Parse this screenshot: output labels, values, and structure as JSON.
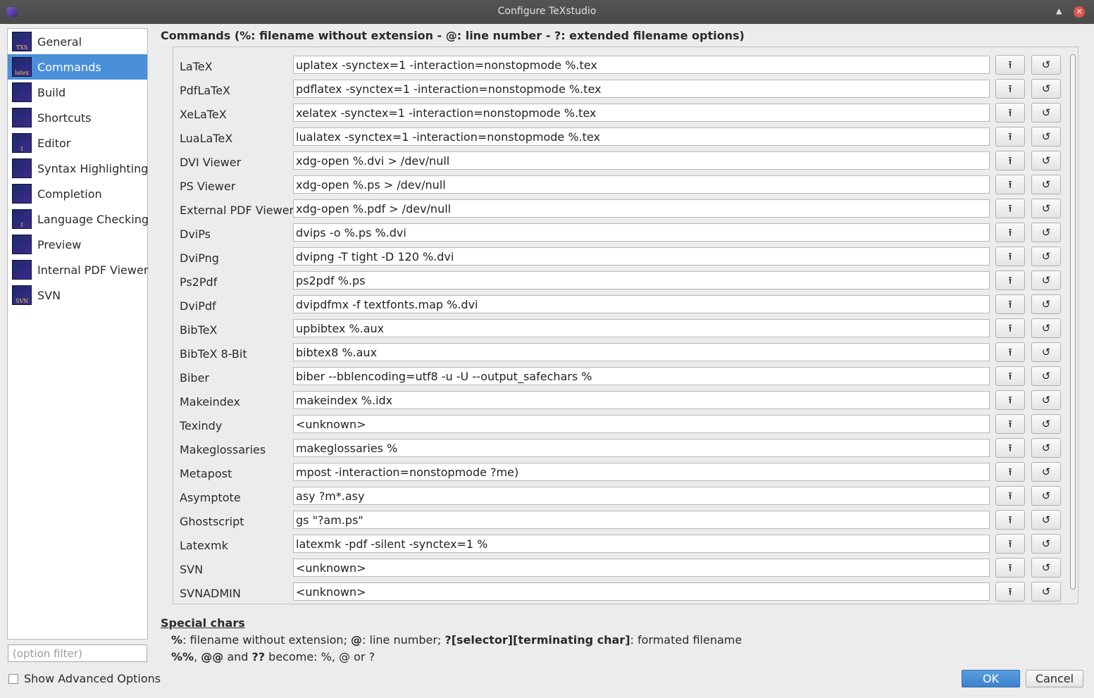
{
  "window": {
    "title": "Configure TeXstudio",
    "maximize_glyph": "▲",
    "close_glyph": "✕"
  },
  "sidebar": {
    "items": [
      {
        "label": "General",
        "icon": "txs-icon",
        "icon_text": "TXS"
      },
      {
        "label": "Commands",
        "icon": "latex-icon",
        "icon_text": "latex"
      },
      {
        "label": "Build",
        "icon": "build-icon",
        "icon_text": ""
      },
      {
        "label": "Shortcuts",
        "icon": "keyboard-icon",
        "icon_text": ""
      },
      {
        "label": "Editor",
        "icon": "text-cursor-icon",
        "icon_text": "I"
      },
      {
        "label": "Syntax Highlighting",
        "icon": "highlight-icon",
        "icon_text": ""
      },
      {
        "label": "Completion",
        "icon": "completion-icon",
        "icon_text": ""
      },
      {
        "label": "Language Checking",
        "icon": "spellcheck-icon",
        "icon_text": "I"
      },
      {
        "label": "Preview",
        "icon": "preview-icon",
        "icon_text": ""
      },
      {
        "label": "Internal PDF Viewer",
        "icon": "pdf-viewer-icon",
        "icon_text": ""
      },
      {
        "label": "SVN",
        "icon": "svn-icon",
        "icon_text": "SVN"
      }
    ],
    "selected_index": 1
  },
  "filter": {
    "placeholder": "(option filter)",
    "value": ""
  },
  "advanced": {
    "label": "Show Advanced Options",
    "checked": false
  },
  "commands": {
    "heading": "Commands (%: filename without extension - @: line number - ?: extended filename options)",
    "browse_glyph": "⭱",
    "reset_glyph": "↺",
    "rows": [
      {
        "label": "LaTeX",
        "value": "uplatex -synctex=1 -interaction=nonstopmode %.tex"
      },
      {
        "label": "PdfLaTeX",
        "value": "pdflatex -synctex=1 -interaction=nonstopmode %.tex"
      },
      {
        "label": "XeLaTeX",
        "value": "xelatex -synctex=1 -interaction=nonstopmode %.tex"
      },
      {
        "label": "LuaLaTeX",
        "value": "lualatex -synctex=1 -interaction=nonstopmode %.tex"
      },
      {
        "label": "DVI Viewer",
        "value": "xdg-open %.dvi > /dev/null"
      },
      {
        "label": "PS Viewer",
        "value": "xdg-open %.ps > /dev/null"
      },
      {
        "label": "External PDF Viewer",
        "value": "xdg-open %.pdf > /dev/null"
      },
      {
        "label": "DviPs",
        "value": "dvips -o %.ps %.dvi"
      },
      {
        "label": "DviPng",
        "value": "dvipng -T tight -D 120 %.dvi"
      },
      {
        "label": "Ps2Pdf",
        "value": "ps2pdf %.ps"
      },
      {
        "label": "DviPdf",
        "value": "dvipdfmx -f textfonts.map %.dvi"
      },
      {
        "label": "BibTeX",
        "value": "upbibtex %.aux"
      },
      {
        "label": "BibTeX 8-Bit",
        "value": "bibtex8 %.aux"
      },
      {
        "label": "Biber",
        "value": "biber --bblencoding=utf8 -u -U --output_safechars %"
      },
      {
        "label": "Makeindex",
        "value": "makeindex %.idx"
      },
      {
        "label": "Texindy",
        "value": "<unknown>"
      },
      {
        "label": "Makeglossaries",
        "value": "makeglossaries %"
      },
      {
        "label": "Metapost",
        "value": "mpost -interaction=nonstopmode ?me)"
      },
      {
        "label": "Asymptote",
        "value": "asy ?m*.asy"
      },
      {
        "label": "Ghostscript",
        "value": "gs \"?am.ps\""
      },
      {
        "label": "Latexmk",
        "value": "latexmk -pdf -silent -synctex=1 %"
      },
      {
        "label": "SVN",
        "value": "<unknown>"
      },
      {
        "label": "SVNADMIN",
        "value": "<unknown>"
      }
    ]
  },
  "special": {
    "title": "Special chars",
    "line1": [
      {
        "text": "%",
        "bold": true
      },
      {
        "text": ": filename without extension; ",
        "bold": false
      },
      {
        "text": "@",
        "bold": true
      },
      {
        "text": ": line number; ",
        "bold": false
      },
      {
        "text": "?[selector][terminating char]",
        "bold": true
      },
      {
        "text": ": formated filename",
        "bold": false
      }
    ],
    "line2": [
      {
        "text": "%%",
        "bold": true
      },
      {
        "text": ", ",
        "bold": false
      },
      {
        "text": "@@",
        "bold": true
      },
      {
        "text": " and ",
        "bold": false
      },
      {
        "text": "??",
        "bold": true
      },
      {
        "text": " become: %, @ or ?",
        "bold": false
      }
    ]
  },
  "buttons": {
    "ok": "OK",
    "cancel": "Cancel"
  },
  "colors": {
    "selection": "#4a90d9",
    "ok_button": "#3d82cc",
    "titlebar": "#4a4a4a"
  }
}
